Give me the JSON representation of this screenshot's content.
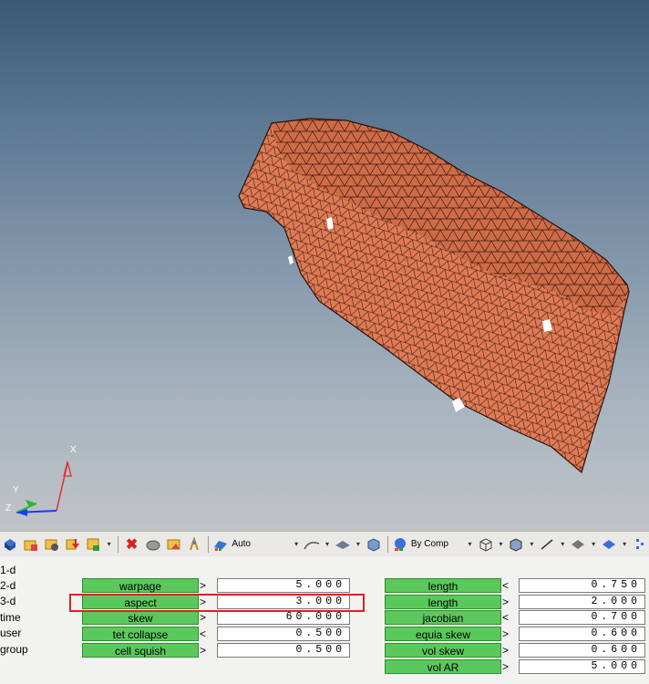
{
  "viewport": {
    "model": "tetra-meshed-part",
    "mesh_color": "#e07a55",
    "triad": {
      "x_label": "X",
      "y_label": "Y",
      "z_label": "Z"
    }
  },
  "toolbar": {
    "icons": [
      "cube-icon",
      "folder-hierarchy-icon",
      "component-icon",
      "import-icon",
      "organize-icon",
      "delete-icon",
      "mask-icon",
      "unmask-icon",
      "reverse-icon"
    ],
    "display_mode": "Auto",
    "color_mode": "By Comp"
  },
  "panel": {
    "side_tabs": [
      "1-d",
      "2-d",
      "3-d",
      "time",
      "user",
      "group"
    ],
    "left_criteria": [
      {
        "label": "warpage",
        "cmp": ">",
        "value": "5.000"
      },
      {
        "label": "aspect",
        "cmp": ">",
        "value": "3.000"
      },
      {
        "label": "skew",
        "cmp": ">",
        "value": "60.000"
      },
      {
        "label": "tet collapse",
        "cmp": "<",
        "value": "0.500"
      },
      {
        "label": "cell squish",
        "cmp": ">",
        "value": "0.500"
      }
    ],
    "right_criteria": [
      {
        "label": "length",
        "cmp": "<",
        "value": "0.750"
      },
      {
        "label": "length",
        "cmp": ">",
        "value": "2.000"
      },
      {
        "label": "jacobian",
        "cmp": "<",
        "value": "0.700"
      },
      {
        "label": "equia skew",
        "cmp": ">",
        "value": "0.600"
      },
      {
        "label": "vol skew",
        "cmp": ">",
        "value": "0.600"
      },
      {
        "label": "vol AR",
        "cmp": ">",
        "value": "5.000"
      }
    ],
    "highlight_color": "#e02020"
  }
}
